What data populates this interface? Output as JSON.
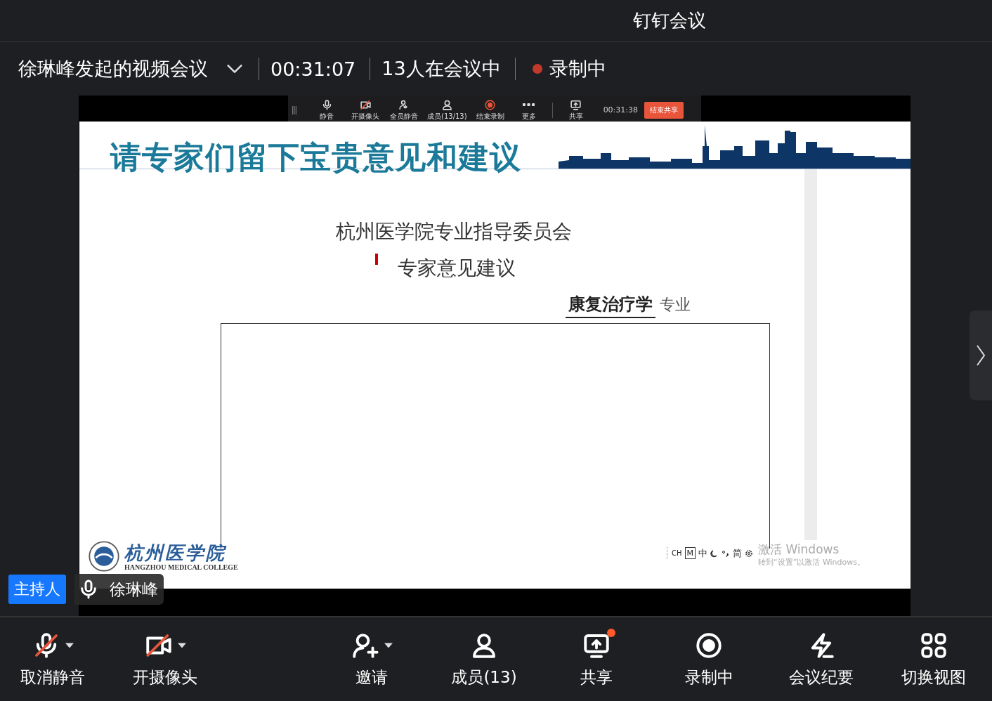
{
  "window": {
    "title": "钉钉会议"
  },
  "meeting_bar": {
    "title": "徐琳峰发起的视频会议",
    "duration": "00:31:07",
    "participants": "13人在会议中",
    "recording": {
      "label": "录制中",
      "on": true
    }
  },
  "share_toolbar": {
    "items": [
      {
        "label": "静音",
        "kind": "mic"
      },
      {
        "label": "开摄像头",
        "kind": "camera-off"
      },
      {
        "label": "全员静音",
        "kind": "mute-all"
      },
      {
        "label": "成员(13/13)",
        "kind": "members"
      },
      {
        "label": "结束录制",
        "kind": "record"
      },
      {
        "label": "更多",
        "kind": "more"
      },
      {
        "label": "共享",
        "kind": "share"
      }
    ],
    "timer": "00:31:38",
    "stop_button": "结束共享"
  },
  "slide": {
    "title": "请专家们留下宝贵意见和建议",
    "heading": "杭州医学院专业指导委员会",
    "subheading": "专家意见建议",
    "major": "康复治疗学",
    "major_suffix": "专业",
    "logo_name": "杭州医学院",
    "logo_english": "HANGZHOU MEDICAL COLLEGE",
    "ime": [
      "CH",
      "M",
      "中",
      "简"
    ],
    "activation": {
      "title": "激活 Windows",
      "hint": "转到“设置”以激活 Windows。"
    }
  },
  "speaker": {
    "role": "主持人",
    "name": "徐琳峰"
  },
  "toolbar": [
    {
      "label": "取消静音",
      "kind": "mic-off",
      "dropdown": true
    },
    {
      "label": "开摄像头",
      "kind": "camera-off",
      "dropdown": true
    },
    {
      "label": "邀请",
      "kind": "invite",
      "dropdown": true
    },
    {
      "label": "成员(13)",
      "kind": "members",
      "dropdown": false
    },
    {
      "label": "共享",
      "kind": "share",
      "dropdown": false,
      "badge": true
    },
    {
      "label": "录制中",
      "kind": "record",
      "dropdown": false
    },
    {
      "label": "会议纪要",
      "kind": "notes",
      "dropdown": false
    },
    {
      "label": "切换视图",
      "kind": "grid",
      "dropdown": false
    }
  ]
}
